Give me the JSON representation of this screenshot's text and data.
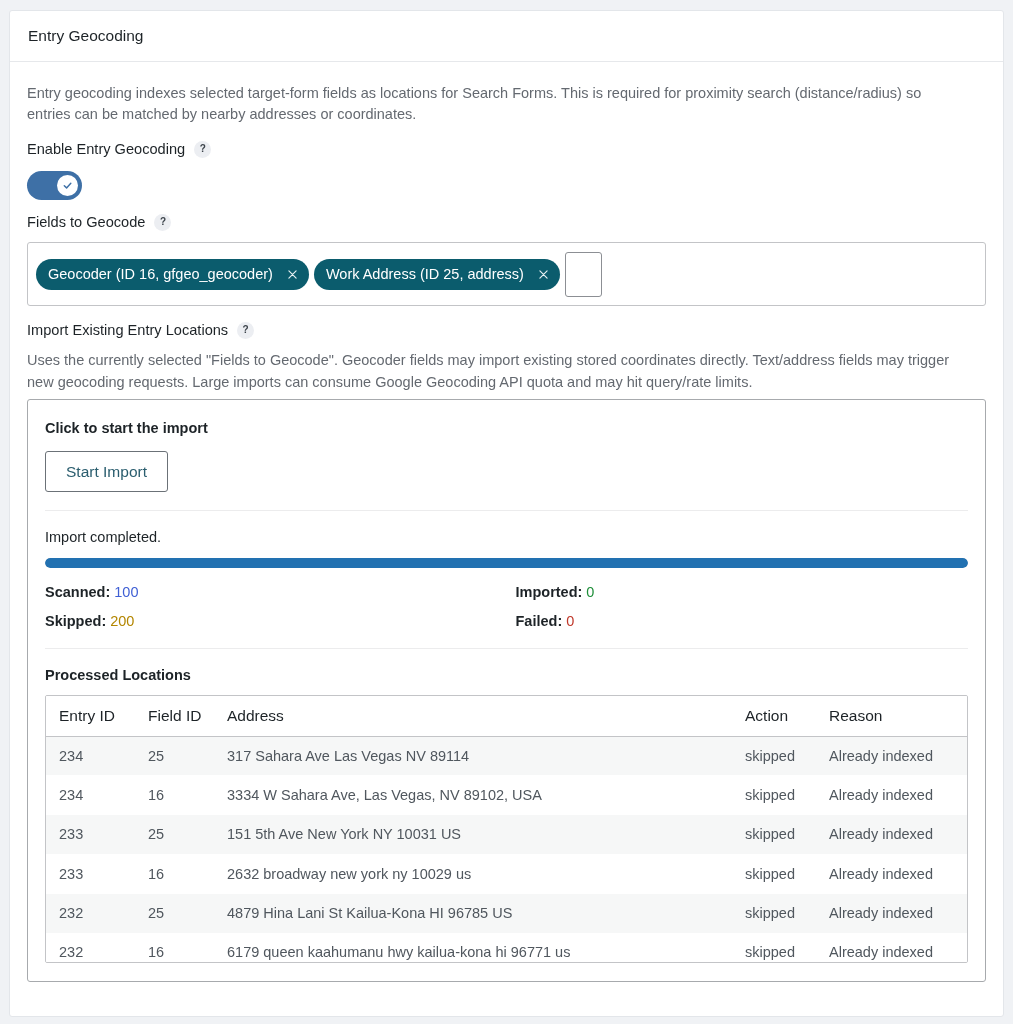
{
  "panel": {
    "title": "Entry Geocoding"
  },
  "intro": "Entry geocoding indexes selected target-form fields as locations for Search Forms. This is required for proximity search (distance/radius) so entries can be matched by nearby addresses or coordinates.",
  "enable_geocoding": {
    "label": "Enable Entry Geocoding",
    "help": "?",
    "on": true
  },
  "fields_to_geocode": {
    "label": "Fields to Geocode",
    "help": "?",
    "tags": [
      {
        "label": "Geocoder (ID 16, gfgeo_geocoder)"
      },
      {
        "label": "Work Address (ID 25, address)"
      }
    ]
  },
  "import": {
    "label": "Import Existing Entry Locations",
    "help": "?",
    "description": "Uses the currently selected \"Fields to Geocode\". Geocoder fields may import existing stored coordinates directly. Text/address fields may trigger new geocoding requests. Large imports can consume Google Geocoding API quota and may hit query/rate limits.",
    "prompt": "Click to start the import",
    "button": "Start Import",
    "status": "Import completed.",
    "progress": {
      "level": 1
    },
    "stats": [
      {
        "label": "Scanned:",
        "value": "100",
        "color": "#3f5fd4"
      },
      {
        "label": "Imported:",
        "value": "0",
        "color": "#1f8f3a"
      },
      {
        "label": "Skipped:",
        "value": "200",
        "color": "#b38600"
      },
      {
        "label": "Failed:",
        "value": "0",
        "color": "#c0392b"
      }
    ],
    "processed": {
      "title": "Processed Locations",
      "columns": [
        "Entry ID",
        "Field ID",
        "Address",
        "Action",
        "Reason"
      ],
      "rows": [
        [
          "234",
          "25",
          "317 Sahara Ave Las Vegas NV 89114",
          "skipped",
          "Already indexed"
        ],
        [
          "234",
          "16",
          "3334 W Sahara Ave, Las Vegas, NV 89102, USA",
          "skipped",
          "Already indexed"
        ],
        [
          "233",
          "25",
          "151 5th Ave New York NY 10031 US",
          "skipped",
          "Already indexed"
        ],
        [
          "233",
          "16",
          "2632 broadway new york ny 10029 us",
          "skipped",
          "Already indexed"
        ],
        [
          "232",
          "25",
          "4879 Hina Lani St Kailua-Kona HI 96785 US",
          "skipped",
          "Already indexed"
        ],
        [
          "232",
          "16",
          "6179 queen kaahumanu hwy kailua-kona hi 96771 us",
          "skipped",
          "Already indexed"
        ]
      ]
    }
  }
}
